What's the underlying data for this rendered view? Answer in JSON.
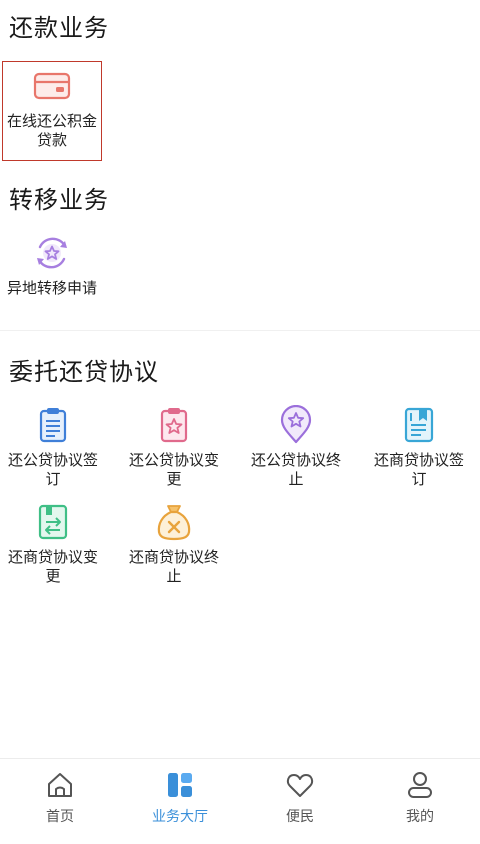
{
  "sections": {
    "repay": {
      "title": "还款业务",
      "items": [
        {
          "label": "在线还公积金贷款",
          "icon": "credit-card-icon"
        }
      ]
    },
    "transfer": {
      "title": "转移业务",
      "items": [
        {
          "label": "异地转移申请",
          "icon": "star-transfer-icon"
        }
      ]
    },
    "agreement": {
      "title": "委托还贷协议",
      "items": [
        {
          "label": "还公贷协议签订",
          "icon": "clipboard-list-icon"
        },
        {
          "label": "还公贷协议变更",
          "icon": "clipboard-star-icon"
        },
        {
          "label": "还公贷协议终止",
          "icon": "location-star-icon"
        },
        {
          "label": "还商贷协议签订",
          "icon": "book-lines-icon"
        },
        {
          "label": "还商贷协议变更",
          "icon": "book-swap-icon"
        },
        {
          "label": "还商贷协议终止",
          "icon": "money-bag-x-icon"
        }
      ]
    }
  },
  "tabbar": {
    "tabs": [
      {
        "label": "首页",
        "icon": "home-icon",
        "active": false
      },
      {
        "label": "业务大厅",
        "icon": "grid-icon",
        "active": true
      },
      {
        "label": "便民",
        "icon": "heart-icon",
        "active": false
      },
      {
        "label": "我的",
        "icon": "user-icon",
        "active": false
      }
    ]
  },
  "colors": {
    "accent": "#3a8fd9",
    "highlight_border": "#c0392b"
  }
}
